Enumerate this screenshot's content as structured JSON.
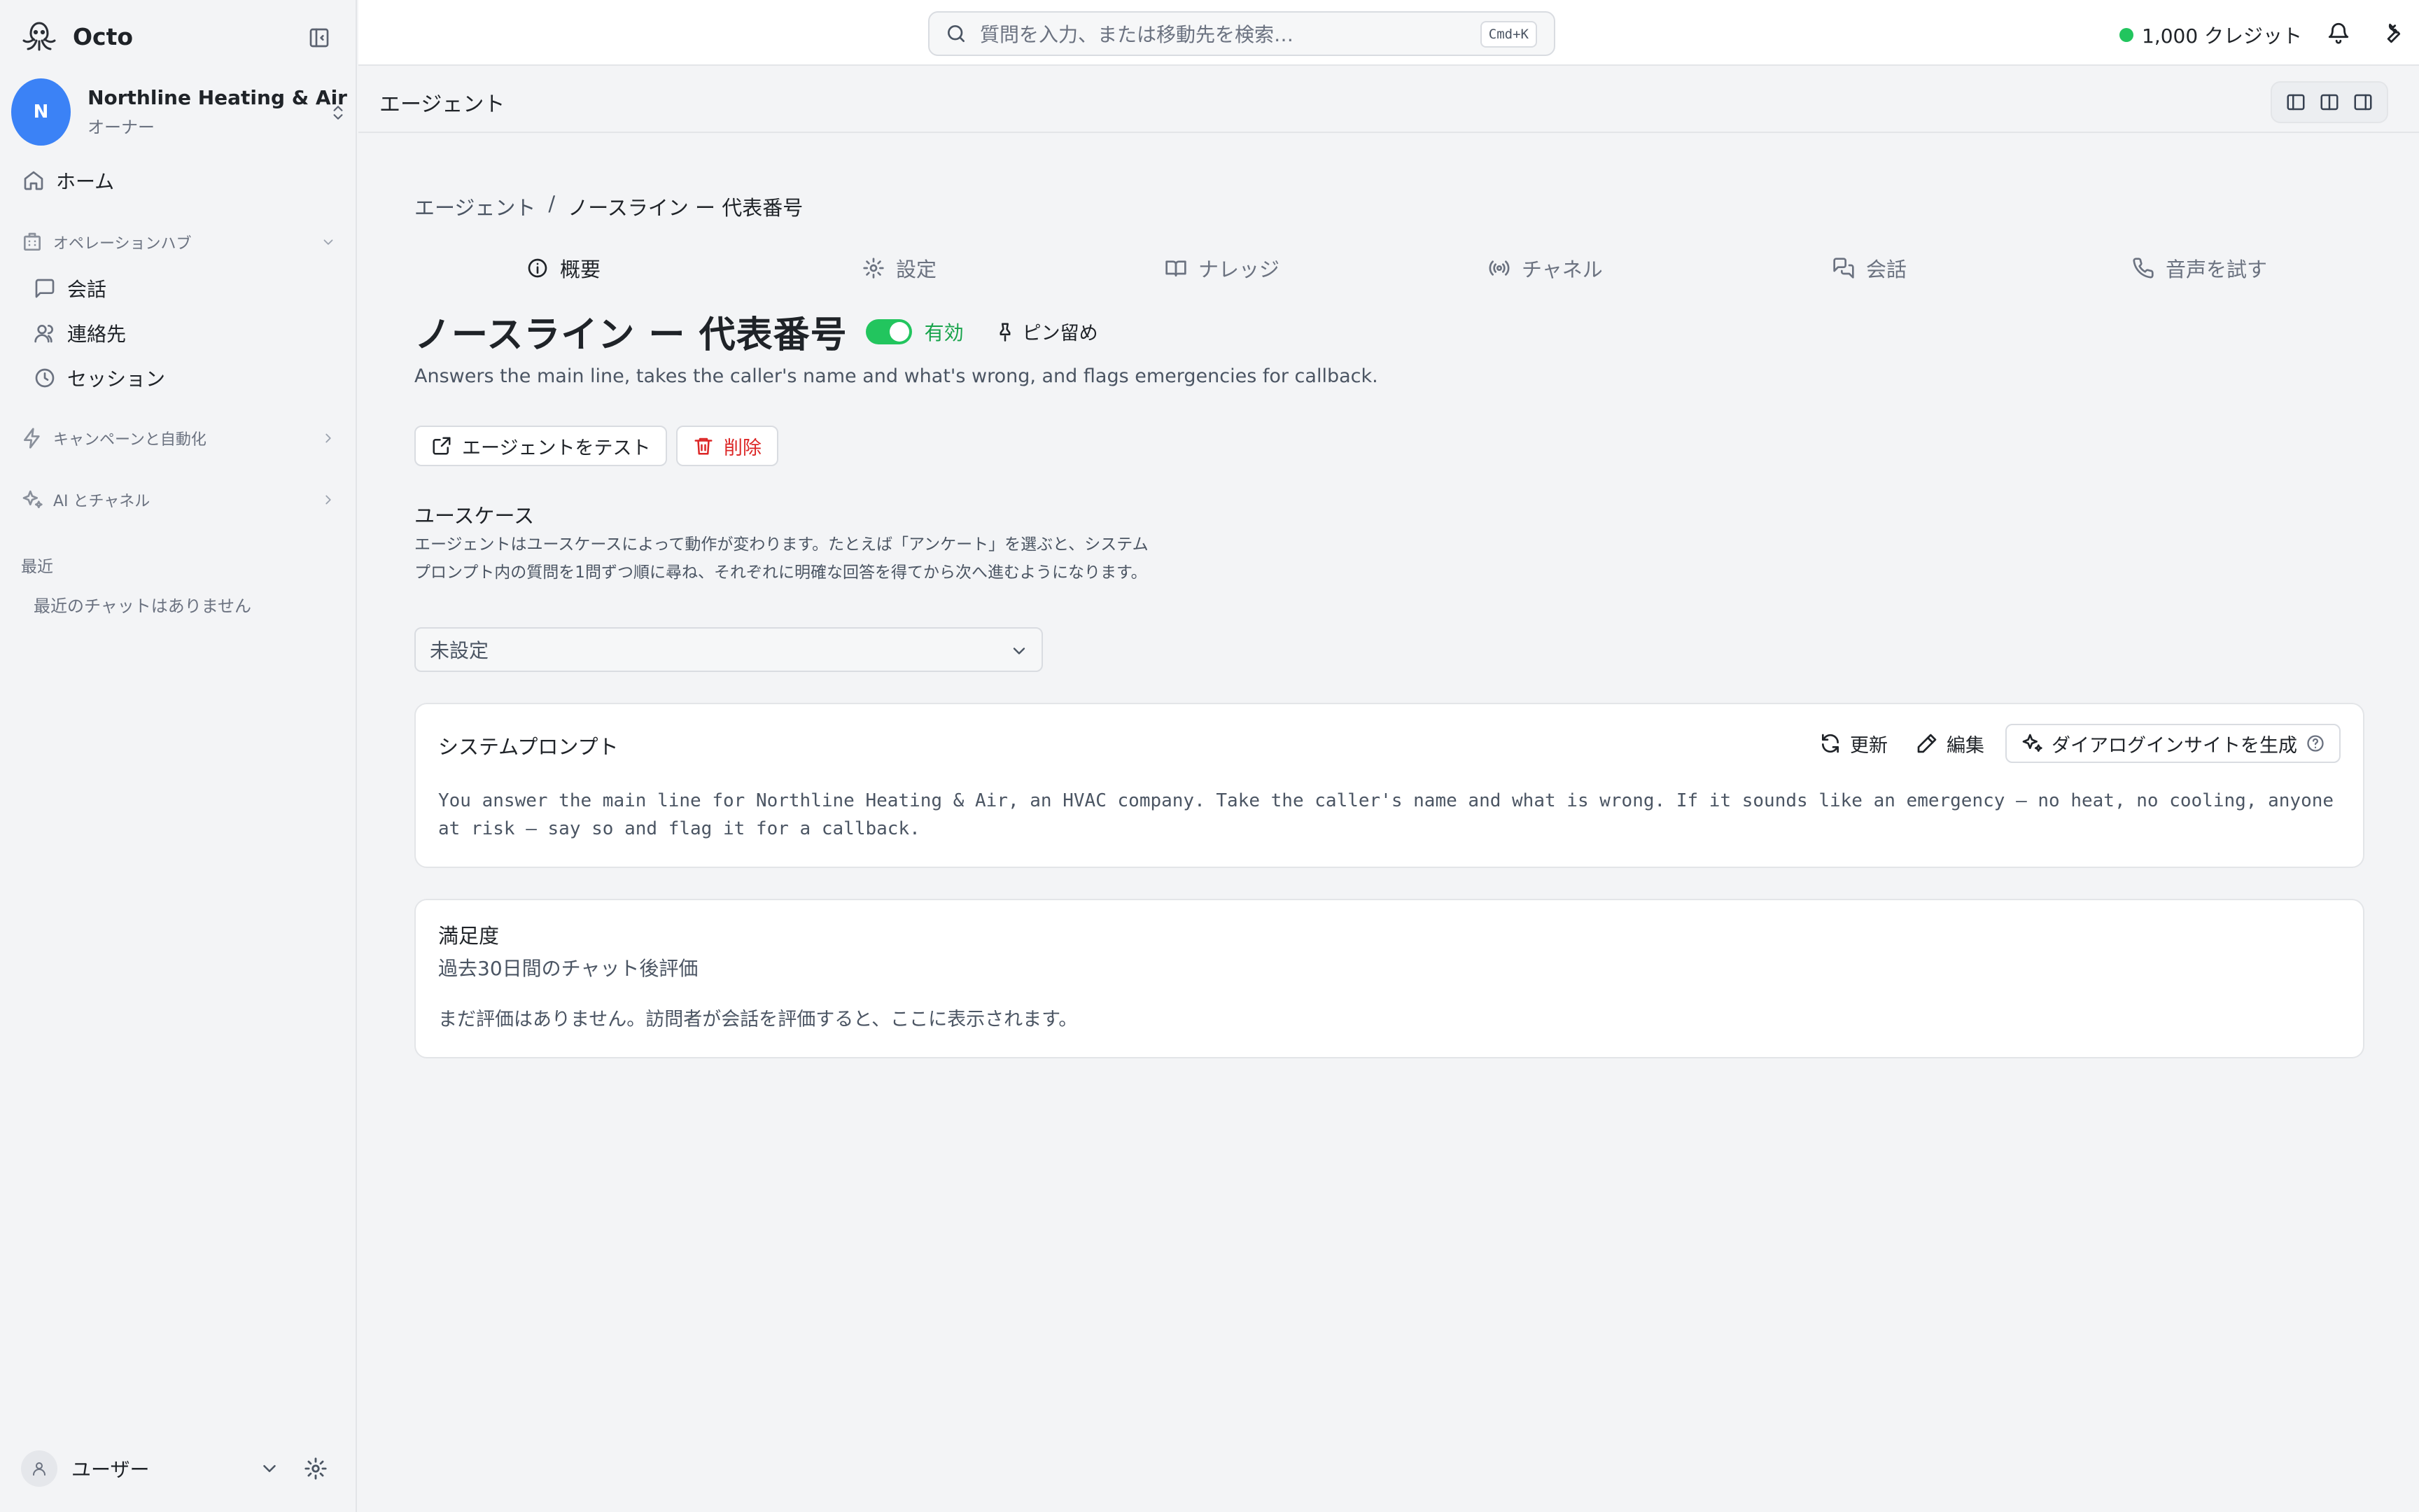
{
  "app": {
    "name": "Octo"
  },
  "org": {
    "initial": "N",
    "name": "Northline Heating & Air",
    "role": "オーナー"
  },
  "sidebar": {
    "home": "ホーム",
    "ops_hub": {
      "label": "オペレーションハブ",
      "items": [
        "会話",
        "連絡先",
        "セッション"
      ]
    },
    "campaigns": "キャンペーンと自動化",
    "ai_channels": "AI とチャネル",
    "recent_label": "最近",
    "recent_empty": "最近のチャットはありません",
    "user": "ユーザー"
  },
  "topbar": {
    "search_placeholder": "質問を入力、または移動先を検索…",
    "shortcut": "Cmd+K",
    "credits": "1,000 クレジット"
  },
  "page": {
    "title": "エージェント"
  },
  "breadcrumb": {
    "root": "エージェント",
    "sep": "/",
    "current": "ノースライン ー 代表番号"
  },
  "tabs": [
    "概要",
    "設定",
    "ナレッジ",
    "チャネル",
    "会話",
    "音声を試す"
  ],
  "agent": {
    "name": "ノースライン ー 代表番号",
    "status": "有効",
    "enabled": true,
    "pin": "ピン留め",
    "description": "Answers the main line, takes the caller's name and what's wrong, and flags emergencies for callback."
  },
  "actions": {
    "test": "エージェントをテスト",
    "delete": "削除"
  },
  "usecase": {
    "label": "ユースケース",
    "help": "エージェントはユースケースによって動作が変わります。たとえば「アンケート」を選ぶと、システムプロンプト内の質問を1問ずつ順に尋ね、それぞれに明確な回答を得てから次へ進むようになります。",
    "value": "未設定"
  },
  "system_prompt": {
    "title": "システムプロンプト",
    "refresh": "更新",
    "edit": "編集",
    "insights": "ダイアログインサイトを生成",
    "body": "You answer the main line for Northline Heating & Air, an HVAC company. Take the caller's name and what is wrong. If it sounds like an emergency — no heat, no cooling, anyone at risk — say so and flag it for a callback."
  },
  "satisfaction": {
    "title": "満足度",
    "subtitle": "過去30日間のチャット後評価",
    "empty": "まだ評価はありません。訪問者が会話を評価すると、ここに表示されます。"
  },
  "colors": {
    "accent_blue": "#3b82f6",
    "success_green": "#22c55e",
    "danger_red": "#dc2626"
  }
}
